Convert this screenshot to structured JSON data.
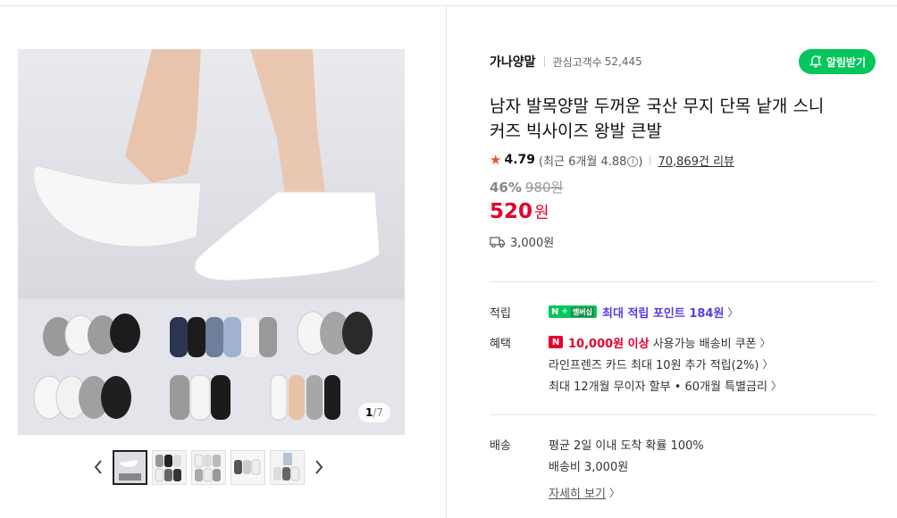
{
  "store": {
    "name": "가나양말",
    "follower_label": "관심고객수",
    "follower_count": "52,445",
    "alarm_button": "알림받기"
  },
  "product": {
    "title": "남자 발목양말 두꺼운 국산 무지 단목 낱개 스니커즈 빅사이즈 왕발 큰발",
    "rating": "4.79",
    "recent_rating_text": "(최근 6개월 4.88",
    "recent_rating_close": ")",
    "review_count": "70,869건 리뷰",
    "discount_rate": "46%",
    "original_price": "980원",
    "price": "520",
    "price_unit": "원",
    "shipping_fee": "3,000원"
  },
  "gallery": {
    "current": "1",
    "total": "7",
    "separator": "/"
  },
  "points": {
    "label": "적립",
    "badge_n": "N",
    "badge_plus": "+",
    "badge_member": "멤버십",
    "text": "최대 적립 포인트 184원"
  },
  "benefits": {
    "label": "혜택",
    "coupon_badge": "N",
    "coupon_strong": "10,000원 이상",
    "coupon_text": " 사용가능 배송비 쿠폰",
    "card_text": "라인프렌즈 카드 최대 10원 추가 적립(2%)",
    "installment_text": "최대 12개월 무이자 할부 • 60개월 특별금리"
  },
  "delivery": {
    "label": "배송",
    "arrival_text": "평균 2일 이내 도착 확률 100%",
    "fee_text": "배송비 3,000원",
    "detail_link": "자세히 보기"
  },
  "colors": {
    "accent_green": "#03c75a",
    "price_red": "#e4002b",
    "point_purple": "#5b3ae6"
  },
  "icons": [
    "bell-plus-icon",
    "star-icon",
    "info-icon",
    "truck-icon",
    "chevron-right-icon",
    "chevron-left-icon"
  ]
}
